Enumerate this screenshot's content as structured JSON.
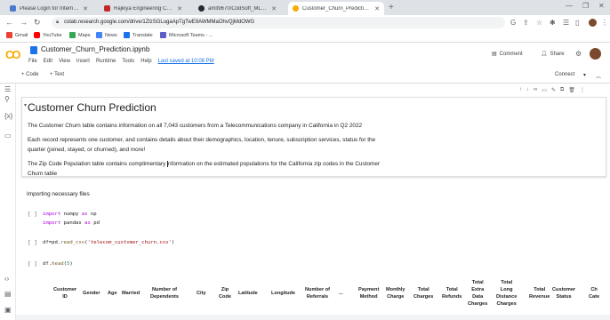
{
  "tabs": [
    {
      "title": "Please Login for Internet access",
      "color": "#4a7bd0"
    },
    {
      "title": "Rajkiya Engineering College, De",
      "color": "#c62828"
    },
    {
      "title": "amit9670/CodSoft_ML_Task4",
      "color": "#24292f"
    },
    {
      "title": "Customer_Churn_Prediction.ipyn",
      "color": "#f9ab00",
      "active": true
    }
  ],
  "address": "colab.research.google.com/drive/1ZlzSGLugaApTgTwE9AWMMaOhvQjMdOWG",
  "bookmarks": [
    "Gmail",
    "YouTube",
    "Maps",
    "News",
    "Translate",
    "Microsoft Teams - ..."
  ],
  "colab": {
    "notebook_name": "Customer_Churn_Prediction.ipynb",
    "menu": [
      "File",
      "Edit",
      "View",
      "Insert",
      "Runtime",
      "Tools",
      "Help"
    ],
    "last_saved": "Last saved at 10:08 PM",
    "comment": "Comment",
    "share": "Share",
    "add_code": "+ Code",
    "add_text": "+ Text",
    "connect": "Connect"
  },
  "markdown_cell": {
    "heading": "Customer Churn Prediction",
    "p1": "The Customer Churn table contains information on all 7,043 customers from a Telecommunications company in California in Q2 2022",
    "p2a": "Each record represents one customer, and contains details about their demographics, location, tenure, subscription services, status for the",
    "p2b": "quarter (joined, stayed, or churned), and more!",
    "p3a": "The Zip Code Population table contains complimentary ",
    "p3b": "nformation on the estimated populations for the California zip codes in the Customer",
    "p3c": "Churn table"
  },
  "section_text": "Importing necessary files",
  "code_cells": {
    "bracket": "[ ]",
    "c1_l1": [
      "import",
      " numpy ",
      "as",
      " np"
    ],
    "c1_l2": [
      "import",
      " pandas ",
      "as",
      " pd"
    ],
    "c2": [
      "df=pd.",
      "read_csv",
      "(",
      "'telecom_customer_churn.csv'",
      ")"
    ],
    "c3": [
      "df.",
      "head",
      "(",
      "5",
      ")"
    ]
  },
  "table_headers": [
    "Customer\nID",
    "Gender",
    "Age",
    "Married",
    "Number of\nDependents",
    "City",
    "Zip\nCode",
    "Latitude",
    "Longitude",
    "Number of\nReferrals",
    "...",
    "Payment\nMethod",
    "Monthly\nCharge",
    "Total\nCharges",
    "Total\nRefunds",
    "Total\nExtra\nData\nCharges",
    "Total\nLong\nDistance\nCharges",
    "Total\nRevenue",
    "Customer\nStatus",
    "Ch\nCate"
  ]
}
